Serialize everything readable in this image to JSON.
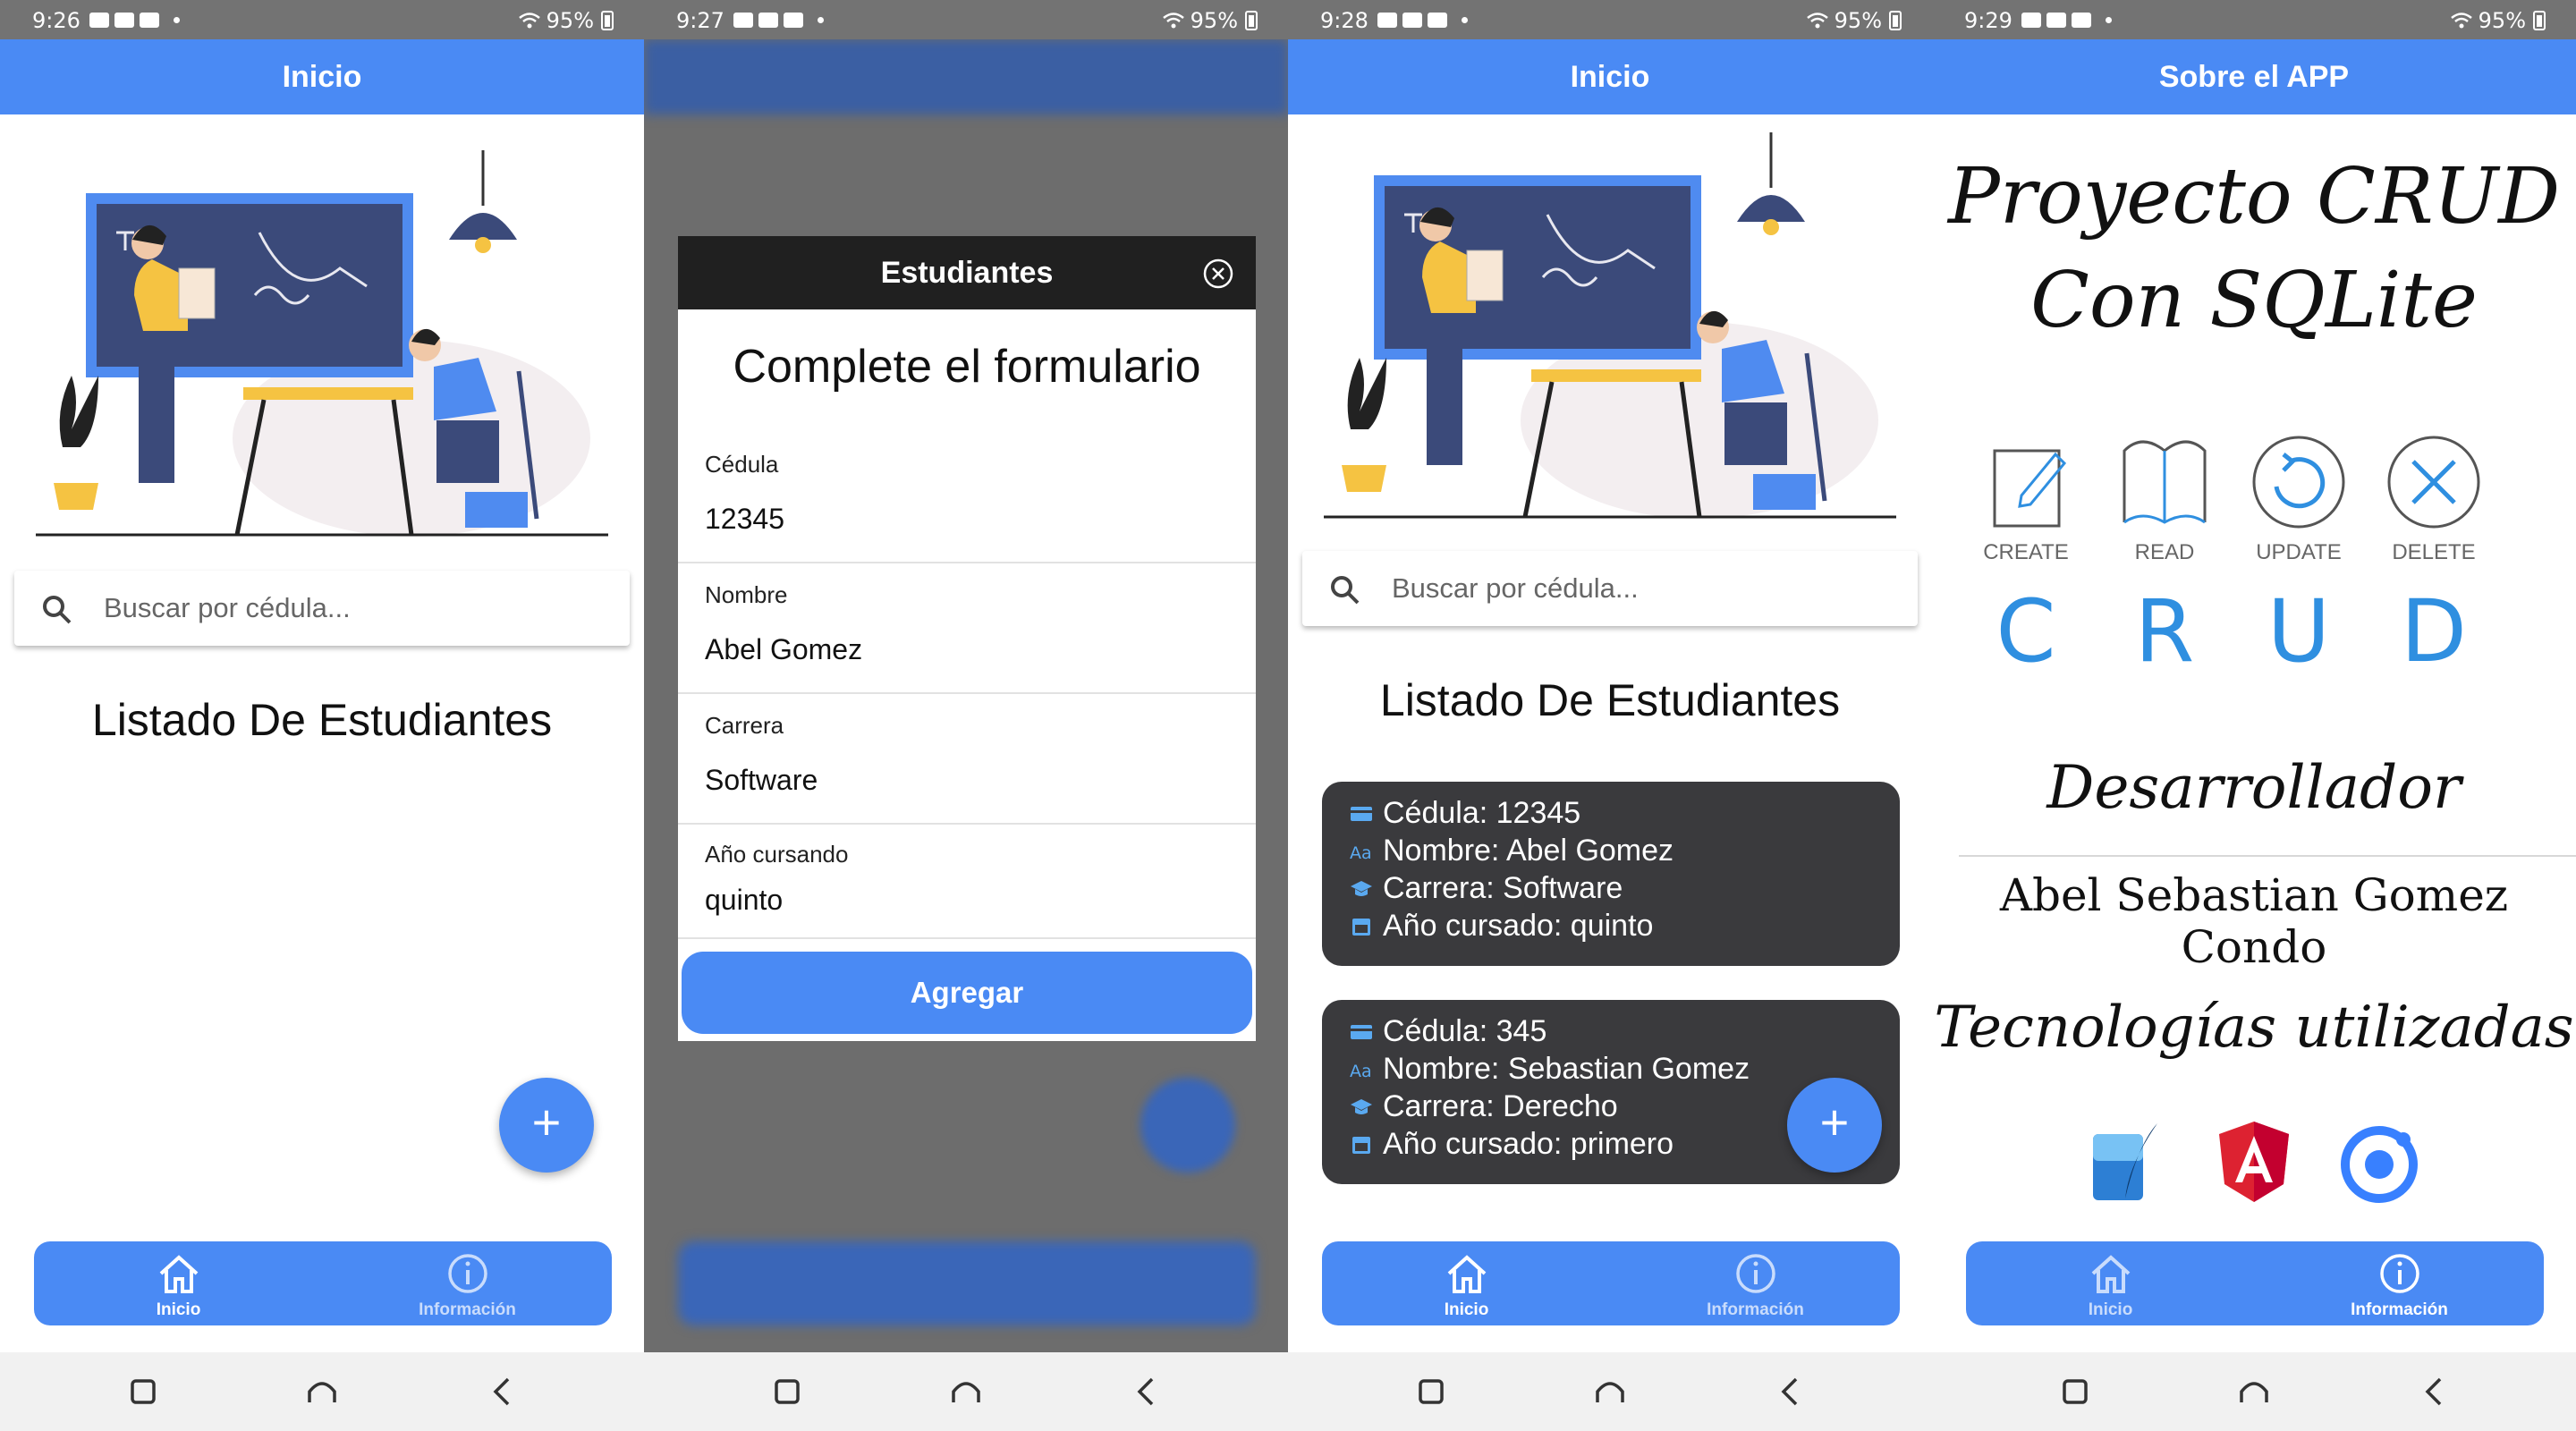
{
  "status": {
    "s1": {
      "time": "9:26",
      "battery": "95%"
    },
    "s2": {
      "time": "9:27",
      "battery": "95%"
    },
    "s3": {
      "time": "9:28",
      "battery": "95%"
    },
    "s4": {
      "time": "9:29",
      "battery": "95%"
    }
  },
  "appbar": {
    "inicio": "Inicio",
    "blurred": "Inicio",
    "about": "Sobre el APP"
  },
  "search": {
    "placeholder": "Buscar por cédula..."
  },
  "list": {
    "title": "Listado De Estudiantes"
  },
  "tabs": [
    {
      "label": "Inicio",
      "icon": "home-icon"
    },
    {
      "label": "Información",
      "icon": "info-icon"
    }
  ],
  "fab": {
    "label": "+"
  },
  "modal": {
    "header": "Estudiantes",
    "title": "Complete el formulario",
    "fields": [
      {
        "label": "Cédula",
        "value": "12345"
      },
      {
        "label": "Nombre",
        "value": "Abel Gomez"
      },
      {
        "label": "Carrera",
        "value": "Software"
      },
      {
        "label": "Año cursando",
        "value": "quinto"
      }
    ],
    "submit": "Agregar"
  },
  "students": [
    {
      "cedula": "Cédula: 12345",
      "nombre": "Nombre: Abel Gomez",
      "carrera": "Carrera: Software",
      "anio": "Año cursado: quinto"
    },
    {
      "cedula": "Cédula: 345",
      "nombre": "Nombre: Sebastian Gomez",
      "carrera": "Carrera: Derecho",
      "anio": "Año cursado: primero"
    }
  ],
  "about": {
    "title_line1": "Proyecto CRUD",
    "title_line2": "Con SQLite",
    "ops": [
      {
        "label": "CREATE",
        "letter": "C"
      },
      {
        "label": "READ",
        "letter": "R"
      },
      {
        "label": "UPDATE",
        "letter": "U"
      },
      {
        "label": "DELETE",
        "letter": "D"
      }
    ],
    "dev_heading": "Desarrollador",
    "dev_name": "Abel Sebastian Gomez Condo",
    "tech_heading": "Tecnologías utilizadas",
    "technologies": [
      "sqlite-icon",
      "angular-icon",
      "ionic-icon"
    ]
  },
  "colors": {
    "primary": "#4a8af4",
    "card": "#3a3a3d",
    "accent": "#2f8fe0",
    "navy": "#3b4a7a"
  }
}
